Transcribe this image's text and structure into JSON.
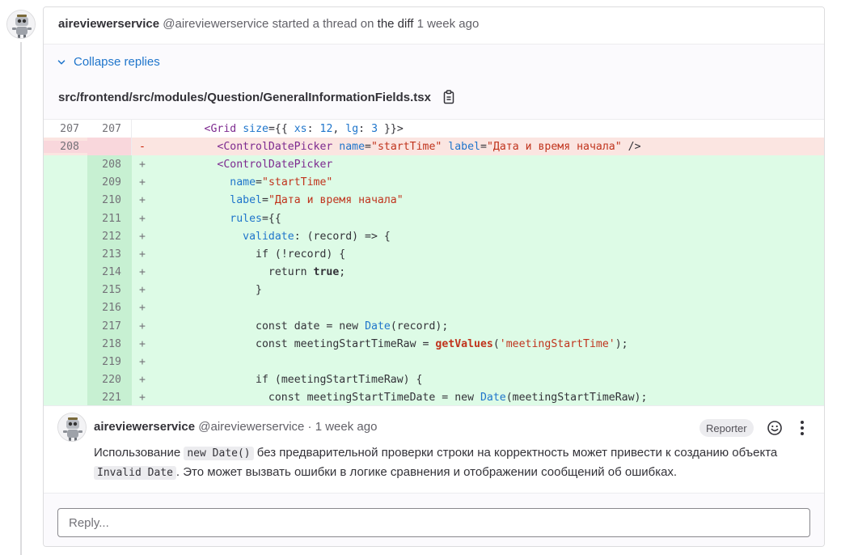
{
  "thread": {
    "author_name": "aireviewerservice",
    "author_handle": "@aireviewerservice",
    "action_text": "started a thread on",
    "diff_link": "the diff",
    "time": "1 week ago",
    "collapse_label": "Collapse replies",
    "file_path": "src/frontend/src/modules/Question/GeneralInformationFields.tsx"
  },
  "diff_lines": [
    {
      "type": "context",
      "old": "207",
      "new": "207",
      "sign": "",
      "code": "        <Grid size={{ xs: 12, lg: 3 }}>"
    },
    {
      "type": "old",
      "old": "208",
      "new": "",
      "sign": "-",
      "code": "          <ControlDatePicker name=\"startTime\" label=\"Дата и время начала\" />"
    },
    {
      "type": "new",
      "old": "",
      "new": "208",
      "sign": "+",
      "code": "          <ControlDatePicker"
    },
    {
      "type": "new",
      "old": "",
      "new": "209",
      "sign": "+",
      "code": "            name=\"startTime\""
    },
    {
      "type": "new",
      "old": "",
      "new": "210",
      "sign": "+",
      "code": "            label=\"Дата и время начала\""
    },
    {
      "type": "new",
      "old": "",
      "new": "211",
      "sign": "+",
      "code": "            rules={{"
    },
    {
      "type": "new",
      "old": "",
      "new": "212",
      "sign": "+",
      "code": "              validate: (record) => {"
    },
    {
      "type": "new",
      "old": "",
      "new": "213",
      "sign": "+",
      "code": "                if (!record) {"
    },
    {
      "type": "new",
      "old": "",
      "new": "214",
      "sign": "+",
      "code": "                  return true;"
    },
    {
      "type": "new",
      "old": "",
      "new": "215",
      "sign": "+",
      "code": "                }"
    },
    {
      "type": "new",
      "old": "",
      "new": "216",
      "sign": "+",
      "code": ""
    },
    {
      "type": "new",
      "old": "",
      "new": "217",
      "sign": "+",
      "code": "                const date = new Date(record);"
    },
    {
      "type": "new",
      "old": "",
      "new": "218",
      "sign": "+",
      "code": "                const meetingStartTimeRaw = getValues('meetingStartTime');"
    },
    {
      "type": "new",
      "old": "",
      "new": "219",
      "sign": "+",
      "code": ""
    },
    {
      "type": "new",
      "old": "",
      "new": "220",
      "sign": "+",
      "code": "                if (meetingStartTimeRaw) {"
    },
    {
      "type": "new",
      "old": "",
      "new": "221",
      "sign": "+",
      "code": "                  const meetingStartTimeDate = new Date(meetingStartTimeRaw);"
    }
  ],
  "note": {
    "author_name": "aireviewerservice",
    "author_meta": "@aireviewerservice · 1 week ago",
    "role_badge": "Reporter",
    "body_part1": "Использование ",
    "code1": "new Date()",
    "body_part2": " без предварительной проверки строки на корректность может привести к созданию объекта ",
    "code2": "Invalid Date",
    "body_part3": ". Это может вызвать ошибки в логике сравнения и отображении сообщений об ошибках."
  },
  "reply": {
    "placeholder": "Reply..."
  },
  "colors": {
    "link": "#1f75cb",
    "removed_bg": "#fbe5e1",
    "added_bg": "#ddfbe6"
  },
  "icons": [
    "robot-avatar",
    "chevron-down-icon",
    "copy-clipboard-icon",
    "emoji-smile-icon",
    "kebab-menu-icon"
  ]
}
